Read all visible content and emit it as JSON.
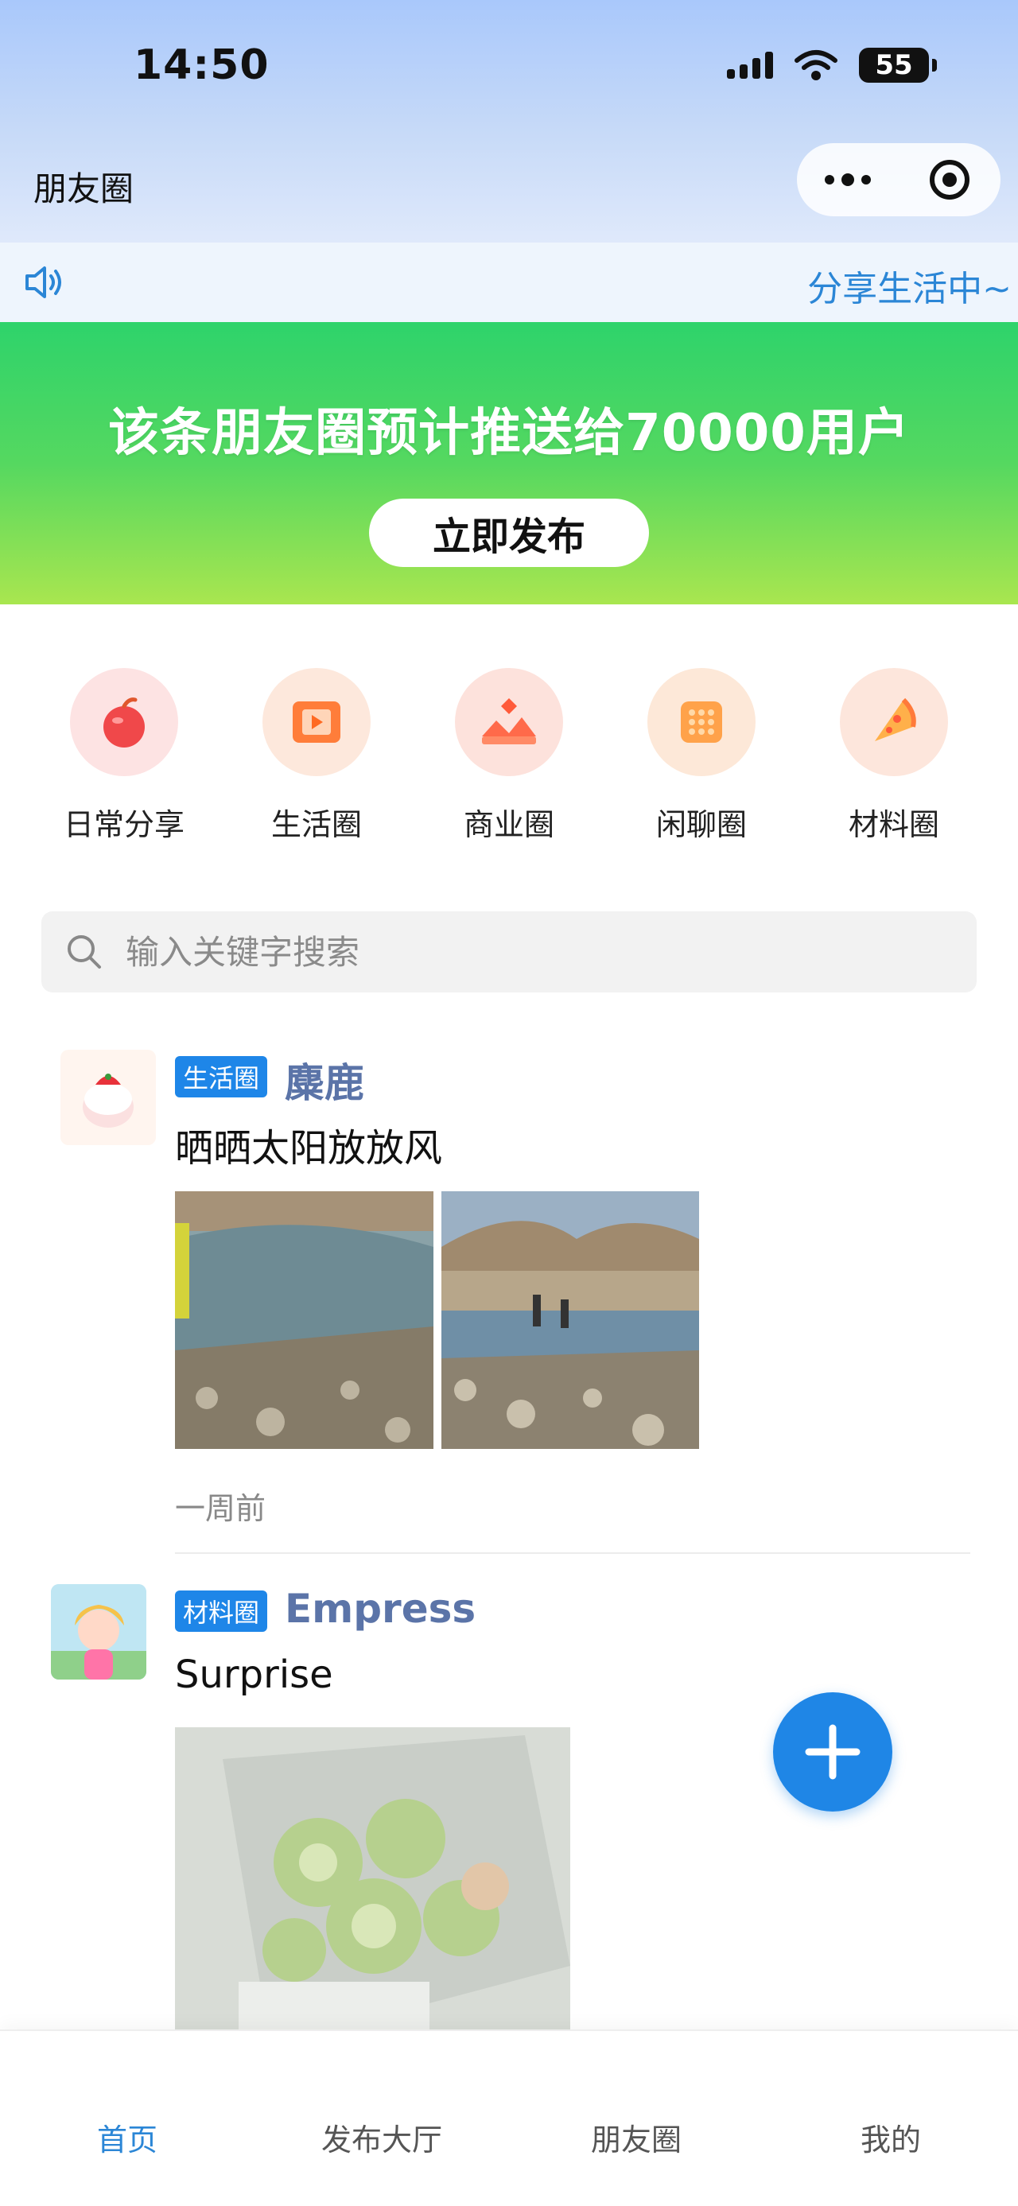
{
  "status_bar": {
    "time": "14:50",
    "battery": "55"
  },
  "nav": {
    "title": "朋友圈",
    "more_icon": "more-dots-icon",
    "close_icon": "target-icon"
  },
  "notice": {
    "icon": "speaker-icon",
    "text": "分享生活中~"
  },
  "banner": {
    "headline": "该条朋友圈预计推送给70000用户",
    "cta": "立即发布",
    "colors": {
      "top": "#2ed36b",
      "bottom": "#a9e64f"
    }
  },
  "categories": [
    {
      "label": "日常分享",
      "icon": "apple-icon"
    },
    {
      "label": "生活圈",
      "icon": "video-play-icon"
    },
    {
      "label": "商业圈",
      "icon": "shop-icon"
    },
    {
      "label": "闲聊圈",
      "icon": "biscuit-icon"
    },
    {
      "label": "材料圈",
      "icon": "pizza-icon"
    }
  ],
  "search": {
    "placeholder": "输入关键字搜索",
    "icon": "search-icon"
  },
  "posts": [
    {
      "tag": "生活圈",
      "author": "麋鹿",
      "content": "晒晒太阳放放风",
      "time": "一周前",
      "images": [
        "river-photo-1",
        "river-photo-2"
      ]
    },
    {
      "tag": "材料圈",
      "author": "Empress",
      "content": "Surprise",
      "images": [
        "flower-bouquet-photo"
      ]
    }
  ],
  "fab": {
    "icon": "plus-icon"
  },
  "tabbar": {
    "items": [
      {
        "label": "首页",
        "active": true
      },
      {
        "label": "发布大厅",
        "active": false
      },
      {
        "label": "朋友圈",
        "active": false
      },
      {
        "label": "我的",
        "active": false
      }
    ]
  },
  "colors": {
    "accent": "#1e86e8",
    "author": "#5b74a8",
    "notice_text": "#2b86d6"
  }
}
